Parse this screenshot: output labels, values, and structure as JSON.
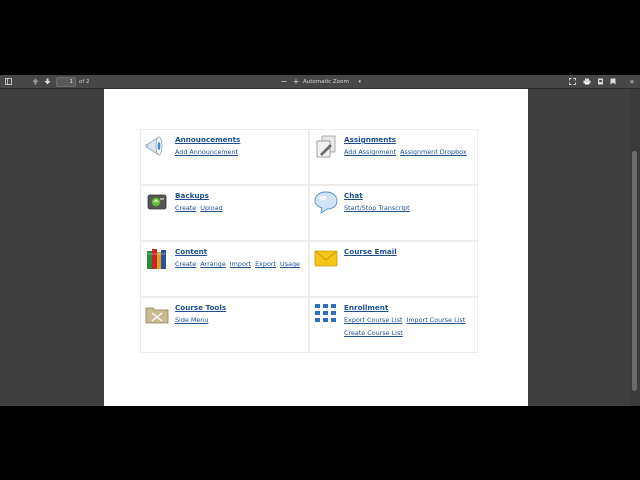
{
  "toolbar": {
    "page_number": "1",
    "page_count": "of 2",
    "zoom_label": "Automatic Zoom",
    "zoom_out": "−",
    "zoom_in": "+"
  },
  "modules": [
    {
      "title": "Announcements",
      "icon": "megaphone-icon",
      "links": [
        "Add Announcement"
      ]
    },
    {
      "title": "Assignments",
      "icon": "assignments-icon",
      "links": [
        "Add Assignment",
        "Assignment Dropbox"
      ]
    },
    {
      "title": "Backups",
      "icon": "backups-icon",
      "links": [
        "Create",
        "Upload"
      ]
    },
    {
      "title": "Chat",
      "icon": "chat-bubble-icon",
      "links": [
        "Start/Stop Transcript"
      ]
    },
    {
      "title": "Content",
      "icon": "books-icon",
      "links": [
        "Create",
        "Arrange",
        "Import",
        "Export",
        "Usage"
      ]
    },
    {
      "title": "Course Email",
      "icon": "envelope-icon",
      "links": []
    },
    {
      "title": "Course Tools",
      "icon": "tools-folder-icon",
      "links": [
        "Side Menu"
      ]
    },
    {
      "title": "Enrollment",
      "icon": "enrollment-grid-icon",
      "links": [
        "Export Course List",
        "Import Course List",
        "Create Course List"
      ]
    }
  ],
  "colors": {
    "link": "#1d4f91",
    "toolbar": "#474747",
    "viewer_bg": "#3f3f3f"
  }
}
